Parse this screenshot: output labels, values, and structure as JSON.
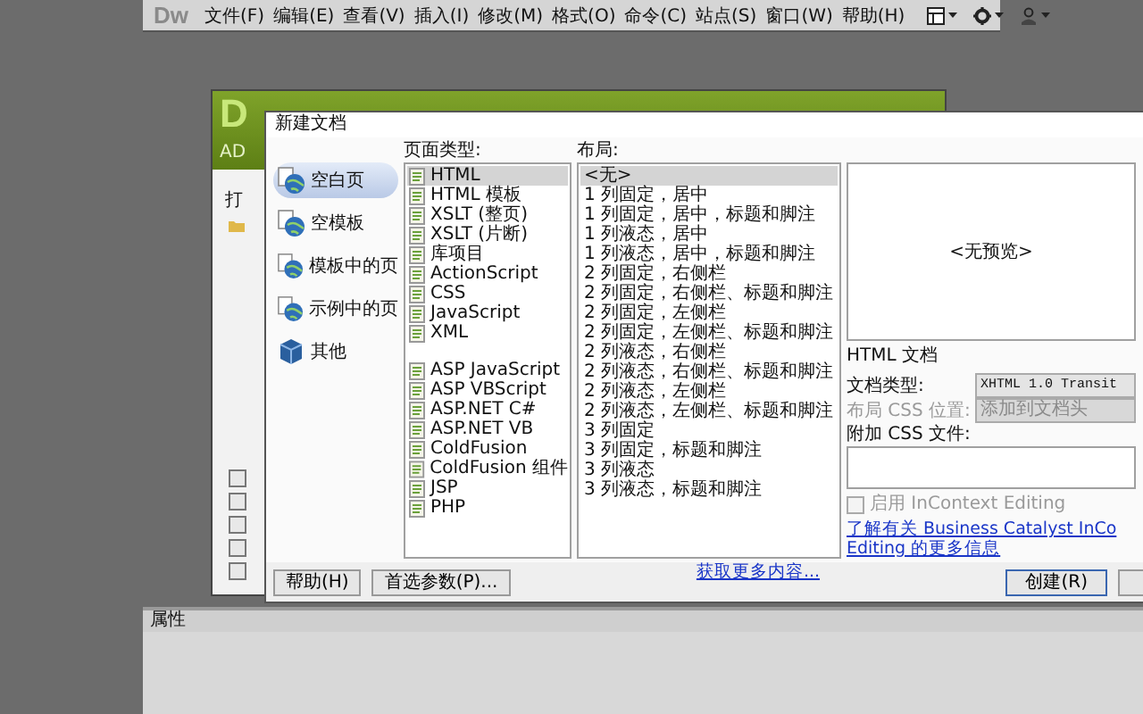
{
  "app": {
    "logo": "Dw",
    "menus": [
      "文件(F)",
      "编辑(E)",
      "查看(V)",
      "插入(I)",
      "修改(M)",
      "格式(O)",
      "命令(C)",
      "站点(S)",
      "窗口(W)",
      "帮助(H)"
    ]
  },
  "welcome": {
    "logo": "D",
    "brand": "AD",
    "open_label": "打",
    "checkboxes": [
      {
        "checked": false
      },
      {
        "checked": false
      },
      {
        "checked": false
      },
      {
        "checked": false
      },
      {
        "checked": false
      }
    ]
  },
  "dialog": {
    "title": "新建文档",
    "categories": [
      {
        "label": "空白页",
        "selected": true,
        "kind": "globe"
      },
      {
        "label": "空模板",
        "selected": false,
        "kind": "globe"
      },
      {
        "label": "模板中的页",
        "selected": false,
        "kind": "globe"
      },
      {
        "label": "示例中的页",
        "selected": false,
        "kind": "globe"
      },
      {
        "label": "其他",
        "selected": false,
        "kind": "box"
      }
    ],
    "page_type_header": "页面类型:",
    "page_type_groups": [
      {
        "items": [
          {
            "label": "HTML",
            "selected": true
          },
          {
            "label": "HTML 模板",
            "selected": false
          },
          {
            "label": "XSLT (整页)",
            "selected": false
          },
          {
            "label": "XSLT (片断)",
            "selected": false
          },
          {
            "label": "库项目",
            "selected": false
          },
          {
            "label": "ActionScript",
            "selected": false
          },
          {
            "label": "CSS",
            "selected": false
          },
          {
            "label": "JavaScript",
            "selected": false
          },
          {
            "label": "XML",
            "selected": false
          }
        ]
      },
      {
        "items": [
          {
            "label": "ASP JavaScript",
            "selected": false
          },
          {
            "label": "ASP VBScript",
            "selected": false
          },
          {
            "label": "ASP.NET C#",
            "selected": false
          },
          {
            "label": "ASP.NET VB",
            "selected": false
          },
          {
            "label": "ColdFusion",
            "selected": false
          },
          {
            "label": "ColdFusion 组件",
            "selected": false
          },
          {
            "label": "JSP",
            "selected": false
          },
          {
            "label": "PHP",
            "selected": false
          }
        ]
      }
    ],
    "layout_header": "布局:",
    "layouts": [
      {
        "label": "<无>",
        "selected": true
      },
      {
        "label": "1 列固定，居中",
        "selected": false
      },
      {
        "label": "1 列固定，居中，标题和脚注",
        "selected": false
      },
      {
        "label": "1 列液态，居中",
        "selected": false
      },
      {
        "label": "1 列液态，居中，标题和脚注",
        "selected": false
      },
      {
        "label": "2 列固定，右侧栏",
        "selected": false
      },
      {
        "label": "2 列固定，右侧栏、标题和脚注",
        "selected": false
      },
      {
        "label": "2 列固定，左侧栏",
        "selected": false
      },
      {
        "label": "2 列固定，左侧栏、标题和脚注",
        "selected": false
      },
      {
        "label": "2 列液态，右侧栏",
        "selected": false
      },
      {
        "label": "2 列液态，右侧栏、标题和脚注",
        "selected": false
      },
      {
        "label": "2 列液态，左侧栏",
        "selected": false
      },
      {
        "label": "2 列液态，左侧栏、标题和脚注",
        "selected": false
      },
      {
        "label": "3 列固定",
        "selected": false
      },
      {
        "label": "3 列固定，标题和脚注",
        "selected": false
      },
      {
        "label": "3 列液态",
        "selected": false
      },
      {
        "label": "3 列液态，标题和脚注",
        "selected": false
      }
    ],
    "preview": {
      "text": "<无预览>",
      "description": "HTML 文档"
    },
    "doctype": {
      "label": "文档类型:",
      "value": "XHTML 1.0 Transit"
    },
    "css_location": {
      "label": "布局 CSS 位置:",
      "value": "添加到文档头",
      "disabled": true
    },
    "attach_css": {
      "label": "附加 CSS 文件:"
    },
    "incontext": {
      "label": "启用 InContext Editing",
      "checked": false,
      "disabled": true
    },
    "learn_more": [
      "了解有关 Business Catalyst InCo",
      "Editing 的更多信息"
    ],
    "buttons_left": [
      "帮助(H)",
      "首选参数(P)..."
    ],
    "more_link": "获取更多内容...",
    "create_button": "创建(R)"
  },
  "properties": {
    "title": "属性"
  }
}
